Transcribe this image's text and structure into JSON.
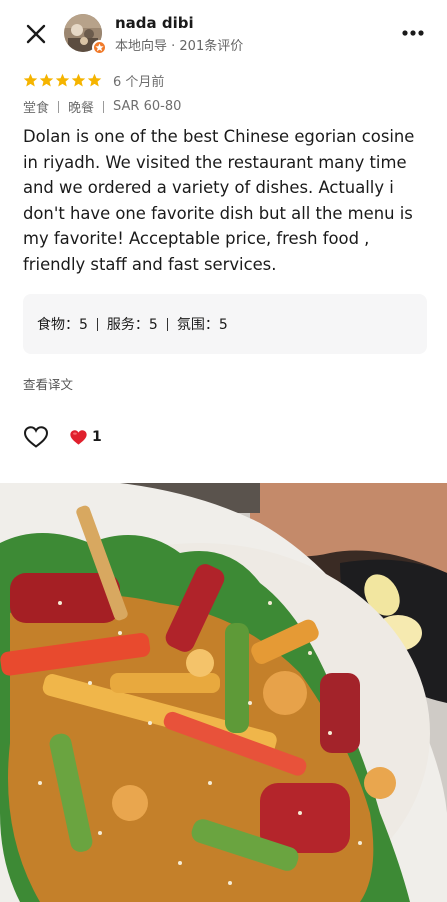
{
  "reviewer": {
    "name": "nada dibi",
    "meta": "本地向导 · 201条评价"
  },
  "review": {
    "rating_stars": 5,
    "time_ago": "6 个月前",
    "tags": [
      "堂食",
      "晚餐",
      "SAR 60-80"
    ],
    "text": "Dolan is one of the best Chinese egorian cosine in riyadh. We visited the restaurant many time and we ordered a variety of dishes. Actually i don't have one favorite dish but all the menu is my favorite! Acceptable price, fresh food , friendly staff and fast services.",
    "scores": [
      {
        "label": "食物：5"
      },
      {
        "label": "服务：5"
      },
      {
        "label": "氛围：5"
      }
    ],
    "translate_link": "查看译文",
    "reaction_count": "1"
  },
  "icons": {
    "close": "close-icon",
    "more": "more-icon",
    "like": "heart-outline-icon",
    "reaction": "red-heart-icon",
    "badge": "local-guide-badge-icon",
    "star": "star-icon"
  },
  "colors": {
    "star": "#f5b400",
    "badge": "#f07a2a",
    "reaction": "#e0202d",
    "score_bg": "#f6f6f7"
  }
}
